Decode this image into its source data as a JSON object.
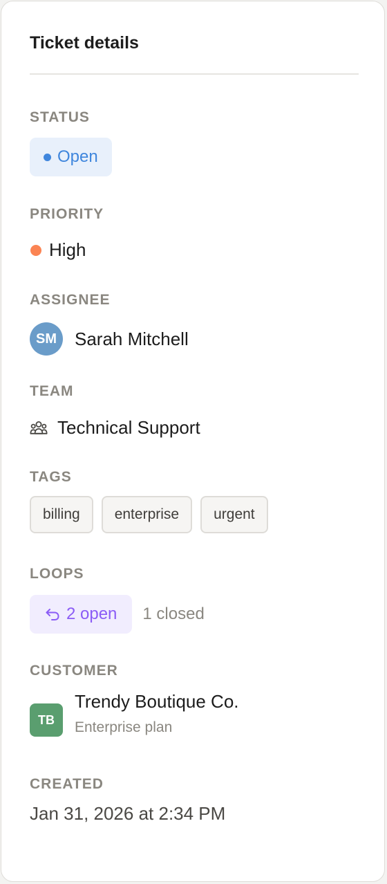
{
  "panel": {
    "title": "Ticket details"
  },
  "status": {
    "label": "STATUS",
    "value": "Open",
    "color": "#3f86dd"
  },
  "priority": {
    "label": "PRIORITY",
    "value": "High",
    "color": "#fb8453"
  },
  "assignee": {
    "label": "ASSIGNEE",
    "initials": "SM",
    "name": "Sarah Mitchell",
    "avatar_color": "#6a9cc9"
  },
  "team": {
    "label": "TEAM",
    "icon": "users-icon",
    "value": "Technical Support"
  },
  "tags": {
    "label": "TAGS",
    "items": [
      "billing",
      "enterprise",
      "urgent"
    ]
  },
  "loops": {
    "label": "LOOPS",
    "icon": "loop-back-arrow-icon",
    "open": "2 open",
    "closed": "1 closed",
    "accent": "#8b5cf6"
  },
  "customer": {
    "label": "CUSTOMER",
    "initials": "TB",
    "name": "Trendy Boutique Co.",
    "plan": "Enterprise plan",
    "avatar_color": "#5a9e6f"
  },
  "created": {
    "label": "CREATED",
    "value": "Jan 31, 2026 at 2:34 PM"
  }
}
